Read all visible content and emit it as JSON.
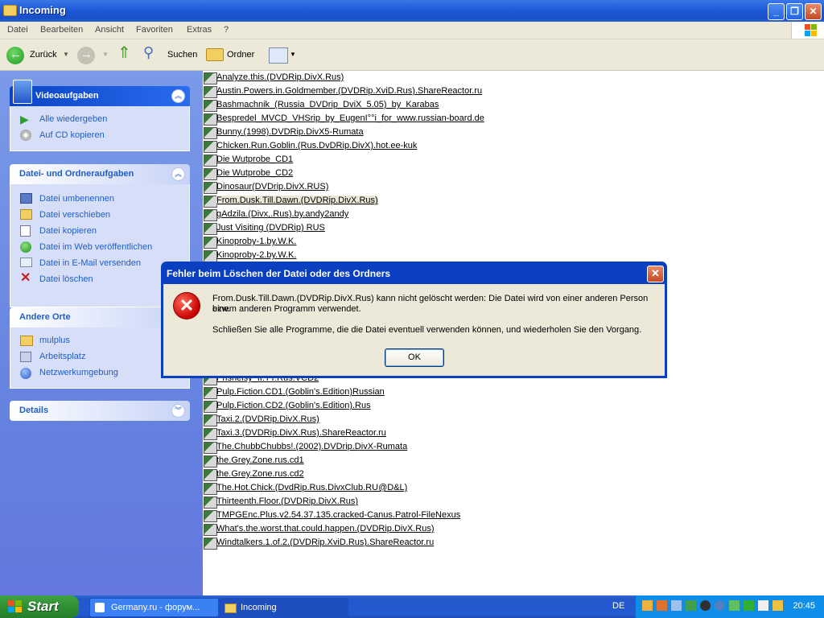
{
  "window": {
    "title": "Incoming"
  },
  "menu": [
    "Datei",
    "Bearbeiten",
    "Ansicht",
    "Favoriten",
    "Extras",
    "?"
  ],
  "toolbar": {
    "back": "Zurück",
    "search": "Suchen",
    "folders": "Ordner"
  },
  "left_panels": {
    "video": {
      "title": "Videoaufgaben",
      "items": [
        "Alle wiedergeben",
        "Auf CD kopieren"
      ]
    },
    "file_tasks": {
      "title": "Datei- und Ordneraufgaben",
      "items": [
        "Datei umbenennen",
        "Datei verschieben",
        "Datei kopieren",
        "Datei im Web veröffentlichen",
        "Datei in E-Mail versenden",
        "Datei löschen"
      ]
    },
    "other_places": {
      "title": "Andere Orte",
      "items": [
        "mulplus",
        "Arbeitsplatz",
        "Netzwerkumgebung"
      ]
    },
    "details": {
      "title": "Details"
    }
  },
  "files_top": [
    "Analyze.this.(DVDRip.DivX.Rus)",
    "Austin.Powers.in.Goldmember.(DVDRip.XviD.Rus).ShareReactor.ru",
    "Bashmachnik_(Russia_DVDrip_DviX_5.05)_by_Karabas",
    "Bespredel_MVCD_VHSrip_by_EugenI°°i_for_www.russian-board.de",
    "Bunny.(1998).DVDRip.DivX5-Rumata",
    "Chicken.Run.Goblin.(Rus.DvDRip.DivX).hot.ee-kuk",
    "Die Wutprobe_CD1",
    "Die Wutprobe_CD2",
    "Dinosaur(DVDrip.DivX.RUS)",
    "From.Dusk.Till.Dawn.(DVDRip.DivX.Rus)",
    "gAdzila.(Divx,.Rus).by.andy2andy",
    "Just Visiting (DVDRip) RUS",
    "Kinoproby-1.by.W.K.",
    "Kinoproby-2.by.W.K."
  ],
  "files_bottom": [
    "Prishelsy_II.TT.Rus.VCD2",
    "Pulp.Fiction.CD1.(Goblin's.Edition)Russian",
    "Pulp.Fiction.CD2.(Goblin's.Edition).Rus",
    "Taxi.2.(DVDRip.DivX.Rus)",
    "Taxi.3.(DVDRip.DivX.Rus).ShareReactor.ru",
    "The.ChubbChubbs!.(2002).DVDrip.DivX-Rumata",
    "the.Grey.Zone.rus.cd1",
    "the.Grey.Zone.rus.cd2",
    "The.Hot.Chick.(DvdRip.Rus.DivxClub.RU@D&L)",
    "Thirteenth.Floor.(DVDRip.DivX.Rus)",
    "TMPGEnc.Plus.v2.54.37.135.cracked-Canus.Patrol-FileNexus",
    "What's.the.worst.that.could.happen.(DVDRip.DivX.Rus)",
    "Windtalkers.1.of.2.(DVDRip.XviD.Rus).ShareReactor.ru"
  ],
  "dialog": {
    "title": "Fehler beim Löschen der Datei oder des Ordners",
    "message1": "From.Dusk.Till.Dawn.(DVDRip.DivX.Rus) kann nicht gelöscht werden: Die Datei wird von einer anderen Person bzw.",
    "message1b": "einem anderen Programm verwendet.",
    "message2": "Schließen Sie alle Programme, die die Datei eventuell verwenden können, und wiederholen Sie den Vorgang.",
    "ok": "OK"
  },
  "taskbar": {
    "start": "Start",
    "tasks": [
      "Germany.ru - форум...",
      "Incoming"
    ],
    "lang": "DE",
    "clock": "20:45"
  },
  "colors": {
    "accent": "#215dc6",
    "titlebar": "#1c5ad8",
    "start": "#2f8f34",
    "error": "#c80000"
  }
}
